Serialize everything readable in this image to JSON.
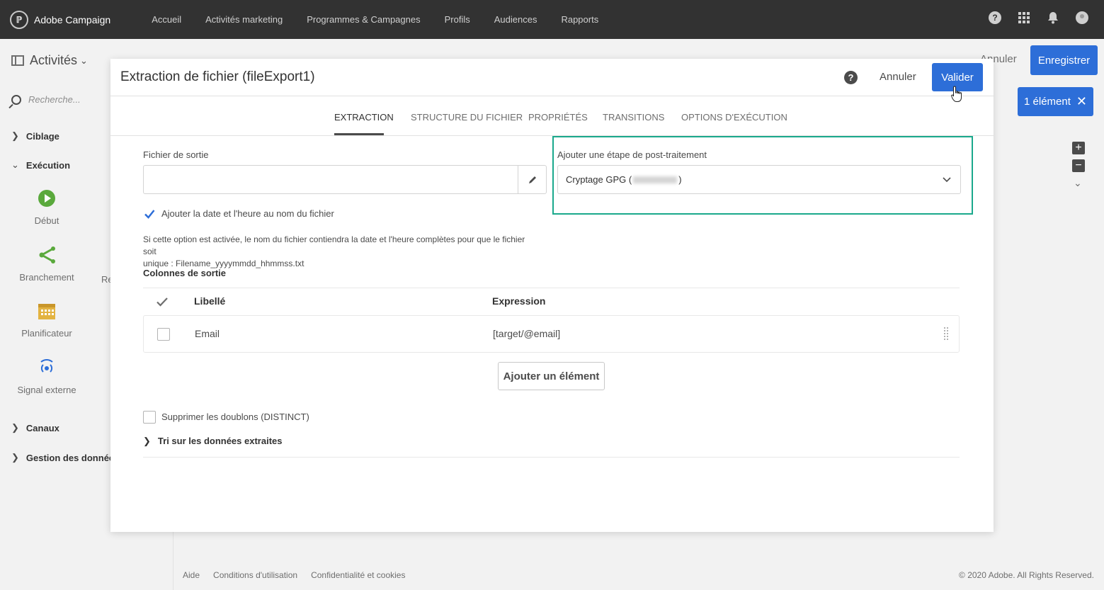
{
  "topnav": {
    "brand": "Adobe Campaign",
    "items": [
      "Accueil",
      "Activités marketing",
      "Programmes & Campagnes",
      "Profils",
      "Audiences",
      "Rapports"
    ],
    "icons": [
      "help-icon",
      "apps-grid-icon",
      "bell-icon",
      "user-avatar-icon"
    ]
  },
  "background": {
    "panel_title": "Activités",
    "annuler": "Annuler",
    "save": "Enregistrer",
    "selection_badge": "1 élément",
    "search_placeholder": "Recherche...",
    "sections": {
      "ciblage": "Ciblage",
      "execution": "Exécution",
      "canaux": "Canaux",
      "gestion": "Gestion des données (I"
    },
    "tiles": {
      "debut": "Début",
      "branchement": "Branchement",
      "cut_off": "Re",
      "planificateur": "Planificateur",
      "signal": "Signal externe"
    },
    "colors": {
      "start_icon": "#5aa93c",
      "branch_icon": "#5aa93c",
      "scheduler_icon": "#e3b341",
      "signal_icon": "#2d6ed8"
    }
  },
  "footer": {
    "links": [
      "Aide",
      "Conditions d'utilisation",
      "Confidentialité et cookies"
    ],
    "copyright": "© 2020 Adobe. All Rights Reserved."
  },
  "modal": {
    "title": "Extraction de fichier (fileExport1)",
    "cancel": "Annuler",
    "validate": "Valider",
    "tabs": [
      "EXTRACTION",
      "STRUCTURE DU FICHIER",
      "PROPRIÉTÉS",
      "TRANSITIONS",
      "OPTIONS D'EXÉCUTION"
    ],
    "active_tab": "EXTRACTION",
    "output_file_label": "Fichier de sortie",
    "output_file_value": "",
    "add_date_label": "Ajouter la date et l'heure au nom du fichier",
    "add_date_checked": true,
    "help_line1": "Si cette option est activée, le nom du fichier contiendra la date et l'heure complètes pour que le fichier soit",
    "help_line2": "unique : Filename_yyyymmdd_hhmmss.txt",
    "post_processing_label": "Ajouter une étape de post-traitement",
    "post_processing_prefix": "Cryptage GPG (",
    "post_processing_suffix": ")",
    "output_columns_label": "Colonnes de sortie",
    "table": {
      "headers": [
        "Libellé",
        "Expression"
      ],
      "rows": [
        {
          "label": "Email",
          "expression": "[target/@email]",
          "checked": false
        }
      ]
    },
    "add_element": "Ajouter un élément",
    "distinct_label": "Supprimer les doublons (DISTINCT)",
    "distinct_checked": false,
    "sort_label": "Tri sur les données extraites",
    "colors": {
      "primary": "#2d6ed8",
      "highlight_border": "#1aa98c"
    }
  }
}
